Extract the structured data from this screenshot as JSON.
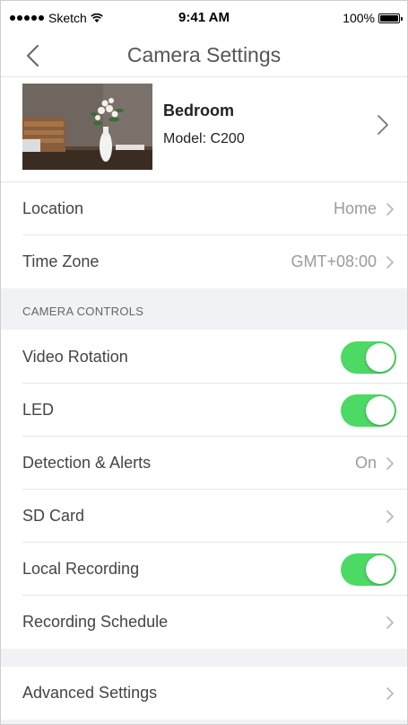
{
  "status_bar": {
    "carrier": "Sketch",
    "time": "9:41 AM",
    "battery": "100%"
  },
  "nav": {
    "title": "Camera Settings"
  },
  "camera": {
    "name": "Bedroom",
    "model": "Model: C200"
  },
  "rows": {
    "location": {
      "label": "Location",
      "value": "Home"
    },
    "time_zone": {
      "label": "Time Zone",
      "value": "GMT+08:00"
    }
  },
  "section": {
    "camera_controls": "CAMERA CONTROLS"
  },
  "controls": {
    "video_rotation": {
      "label": "Video Rotation",
      "on": true
    },
    "led": {
      "label": "LED",
      "on": true
    },
    "detection": {
      "label": "Detection & Alerts",
      "value": "On"
    },
    "sd_card": {
      "label": "SD Card"
    },
    "local_recording": {
      "label": "Local Recording",
      "on": true
    },
    "recording_schedule": {
      "label": "Recording Schedule"
    }
  },
  "advanced": {
    "label": "Advanced Settings"
  },
  "colors": {
    "toggle_on": "#4cd964",
    "section_bg": "#f0f2f6"
  }
}
